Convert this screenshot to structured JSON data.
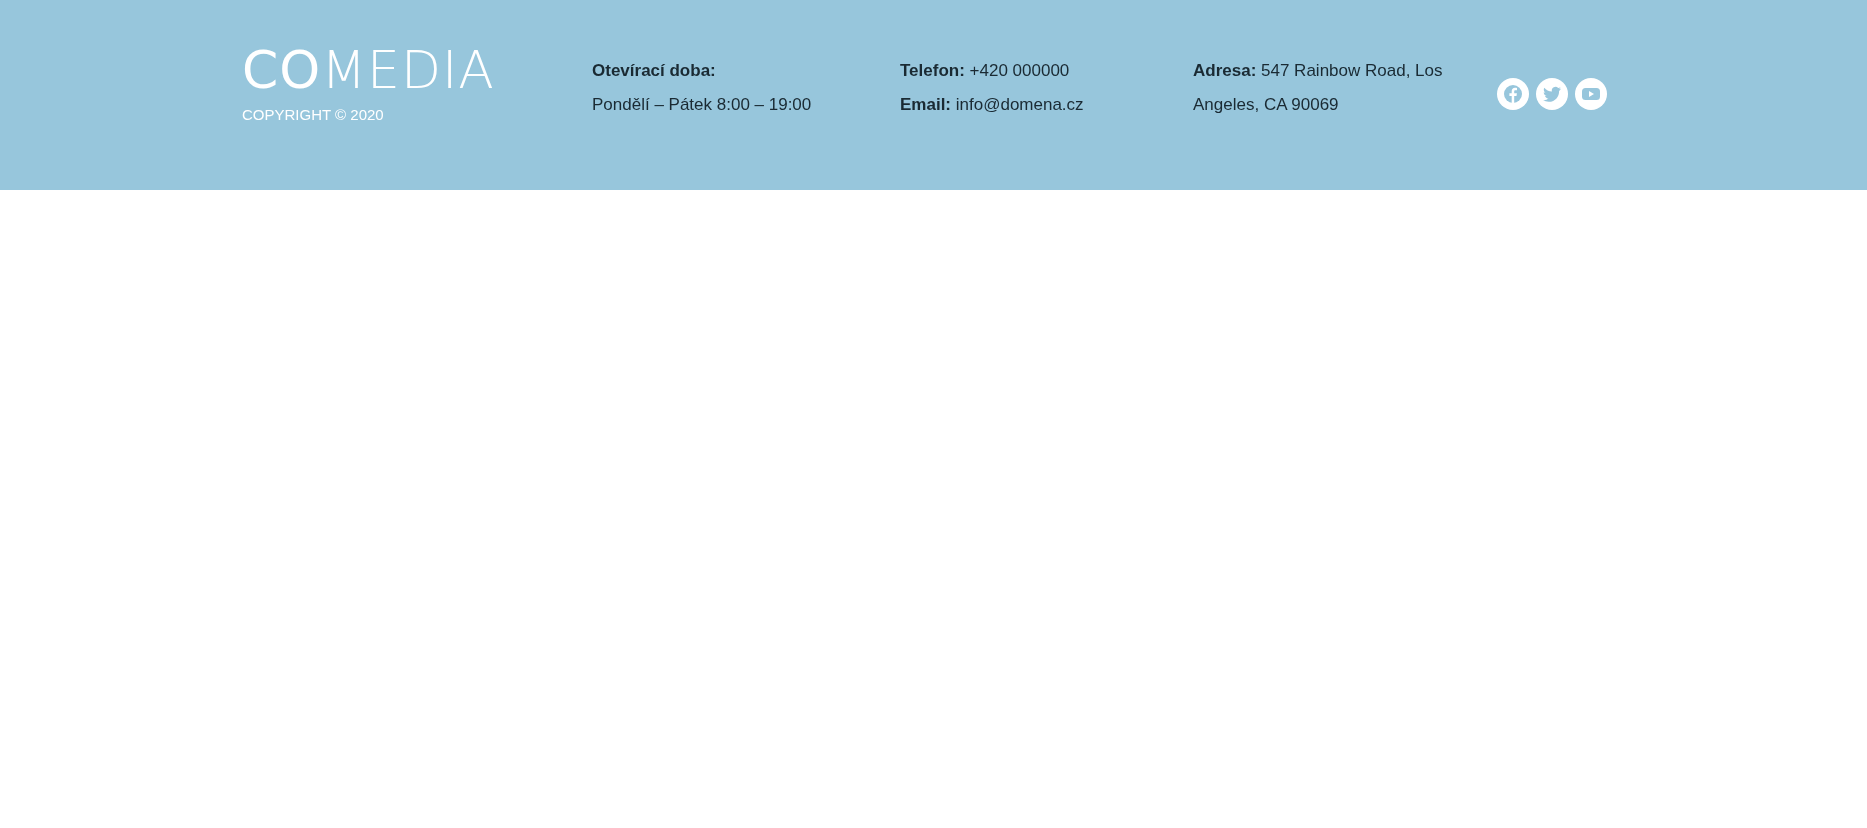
{
  "footer": {
    "logo": "**CO**MEDIA",
    "copyright": "COPYRIGHT © 2020",
    "columns": [
      {
        "lines": [
          "**Otevírací doba:**",
          "Pondělí – Pátek 8:00 – 19:00"
        ]
      },
      {
        "lines": [
          "**Telefon:** +420 000000",
          "**Email:** info@domena.cz"
        ]
      },
      {
        "lines": [
          "**Adresa:** 547 Rainbow Road, Los Angeles, CA 90069"
        ]
      }
    ],
    "social": [
      {
        "kind": "facebook"
      },
      {
        "kind": "twitter"
      },
      {
        "kind": "youtube"
      }
    ]
  }
}
